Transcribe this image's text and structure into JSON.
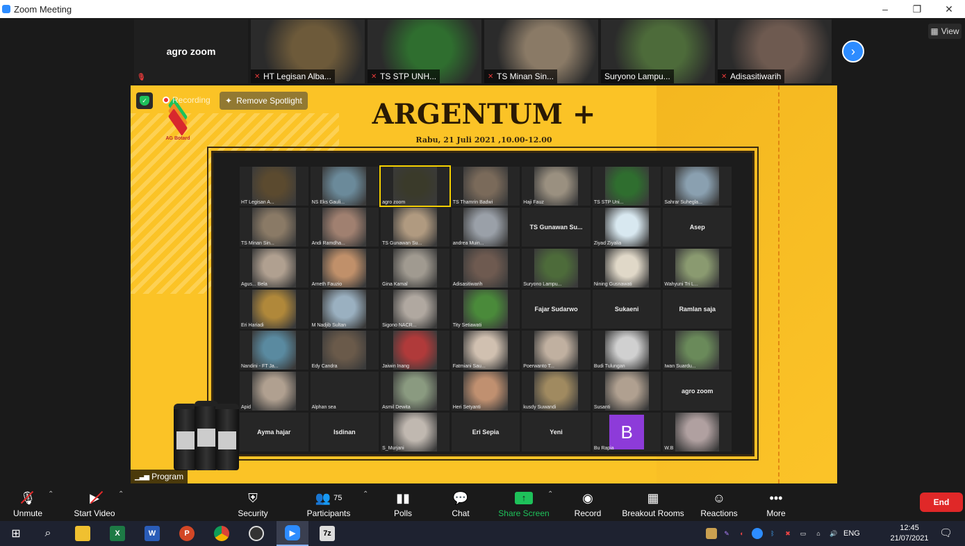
{
  "window": {
    "title": "Zoom Meeting",
    "controls": [
      "–",
      "❐",
      "✕"
    ]
  },
  "strip": {
    "self_tile": "agro zoom",
    "thumbnails": [
      {
        "name": "HT Legisan Alba...",
        "color": "#6d5a3a"
      },
      {
        "name": "TS STP UNH...",
        "color": "#2f6e2f"
      },
      {
        "name": "TS Minan Sin...",
        "color": "#8a7a66"
      },
      {
        "name": "Suryono Lampu...",
        "color": "#4d6b3a"
      },
      {
        "name": "Adisasitiwarih",
        "color": "#6e5a50"
      }
    ],
    "next_icon": "›",
    "view_label": "View"
  },
  "stage": {
    "title": "ARGENTUM +",
    "subtitle": "Rabu, 21 Juli 2021 ,10.00-12.00",
    "logo_text": "AG Botard",
    "recording_label": "Recording",
    "spotlight_label": "Remove Spotlight",
    "program_label": "Program",
    "gallery": [
      {
        "name": "HT Legisan A...",
        "type": "video",
        "color": "#5b4a2f"
      },
      {
        "name": "NS Eks Gauli...",
        "type": "video",
        "color": "#6b8a9a"
      },
      {
        "name": "agro zoom",
        "type": "video",
        "color": "#3a3a2a",
        "active": true
      },
      {
        "name": "TS Thamrin Badwi",
        "type": "video",
        "color": "#7a6a5a"
      },
      {
        "name": "Haji Fauz",
        "type": "video",
        "color": "#9a9080"
      },
      {
        "name": "TS STP Uni...",
        "type": "video",
        "color": "#2f6e2f"
      },
      {
        "name": "Sahrar Suhegla...",
        "type": "video",
        "color": "#8aa0b0"
      },
      {
        "name": "TS Minan Sin...",
        "type": "video",
        "color": "#8a7a66"
      },
      {
        "name": "Andi Ramdha...",
        "type": "video",
        "color": "#a08070"
      },
      {
        "name": "TS Gunawan Su...",
        "type": "video",
        "color": "#b09a80"
      },
      {
        "name": "andrea Muin...",
        "type": "video",
        "color": "#9aa0a8"
      },
      {
        "name": "TS Gunawan Su...",
        "type": "name"
      },
      {
        "name": "Ziyad Ziyalia",
        "type": "video",
        "color": "#d8e8f0"
      },
      {
        "name": "Asep",
        "type": "name"
      },
      {
        "name": "Agus... Bela",
        "type": "video",
        "color": "#b0a090"
      },
      {
        "name": "Arneth Fauzio",
        "type": "video",
        "color": "#c0906a"
      },
      {
        "name": "Gina Kamal",
        "type": "video",
        "color": "#a09a90"
      },
      {
        "name": "Adisasitiwarih",
        "type": "video",
        "color": "#6e5a50"
      },
      {
        "name": "Suryono Lampu...",
        "type": "video",
        "color": "#4d6b3a"
      },
      {
        "name": "Nining Gusnawati",
        "type": "video",
        "color": "#e0d8c8"
      },
      {
        "name": "Wahyuni Tri L...",
        "type": "video",
        "color": "#8a9a70"
      },
      {
        "name": "Eri Hariadi",
        "type": "video",
        "color": "#b0883a"
      },
      {
        "name": "M Nadjib Sultan",
        "type": "video",
        "color": "#9ab0c0"
      },
      {
        "name": "Sigono NACR...",
        "type": "video",
        "color": "#b0a8a0"
      },
      {
        "name": "Tity Setiawati",
        "type": "video",
        "color": "#4a8a3a"
      },
      {
        "name": "Fajar Sudarwo",
        "type": "name"
      },
      {
        "name": "Sukaeni",
        "type": "name"
      },
      {
        "name": "Ramlan saja",
        "type": "name"
      },
      {
        "name": "Nandini - FT Ja...",
        "type": "video",
        "color": "#5a8aa0"
      },
      {
        "name": "Edy Candra",
        "type": "video",
        "color": "#6a5a4a"
      },
      {
        "name": "Jaiwin Inang",
        "type": "video",
        "color": "#b03a3a"
      },
      {
        "name": "Fatmiani Sau...",
        "type": "video",
        "color": "#d0c0b0"
      },
      {
        "name": "Poerwanto T...",
        "type": "video",
        "color": "#c0b0a0"
      },
      {
        "name": "Budi Tulungan",
        "type": "video",
        "color": "#d0d0d0"
      },
      {
        "name": "Iwan Suardu...",
        "type": "video",
        "color": "#6a8a5a"
      },
      {
        "name": "Apid",
        "type": "video",
        "color": "#b0a090"
      },
      {
        "name": "Alphan sea",
        "type": "name-small"
      },
      {
        "name": "Asmil Dewita",
        "type": "video",
        "color": "#8a9a80"
      },
      {
        "name": "Heri Setyanti",
        "type": "video",
        "color": "#c09070"
      },
      {
        "name": "kusdy Suwandi",
        "type": "video",
        "color": "#a08a60"
      },
      {
        "name": "Susanti",
        "type": "video",
        "color": "#b0a090"
      },
      {
        "name": "agro zoom",
        "type": "name"
      },
      {
        "name": "Ayma hajar",
        "type": "name"
      },
      {
        "name": "Isdinan",
        "type": "name"
      },
      {
        "name": "S_Murjani",
        "type": "video",
        "color": "#c0b8b0"
      },
      {
        "name": "Eri Sepia",
        "type": "name"
      },
      {
        "name": "Yeni",
        "type": "name"
      },
      {
        "name": "Bu Rapia",
        "type": "avatar",
        "letter": "B"
      },
      {
        "name": "W.B",
        "type": "video",
        "color": "#b0a0a0"
      }
    ]
  },
  "toolbar": {
    "unmute": "Unmute",
    "start_video": "Start Video",
    "security": "Security",
    "participants": "Participants",
    "participants_count": "75",
    "polls": "Polls",
    "chat": "Chat",
    "share_screen": "Share Screen",
    "record": "Record",
    "breakout_rooms": "Breakout Rooms",
    "reactions": "Reactions",
    "more": "More",
    "end": "End"
  },
  "taskbar": {
    "excel": "X",
    "word": "W",
    "ppt": "P",
    "sevenzip": "7z",
    "lang": "ENG",
    "time": "12:45",
    "date": "21/07/2021"
  },
  "colors": {
    "stage_bg": "#fbc326",
    "zoom_blue": "#2d8cff",
    "share_green": "#1ec15a",
    "end_red": "#e02828"
  }
}
